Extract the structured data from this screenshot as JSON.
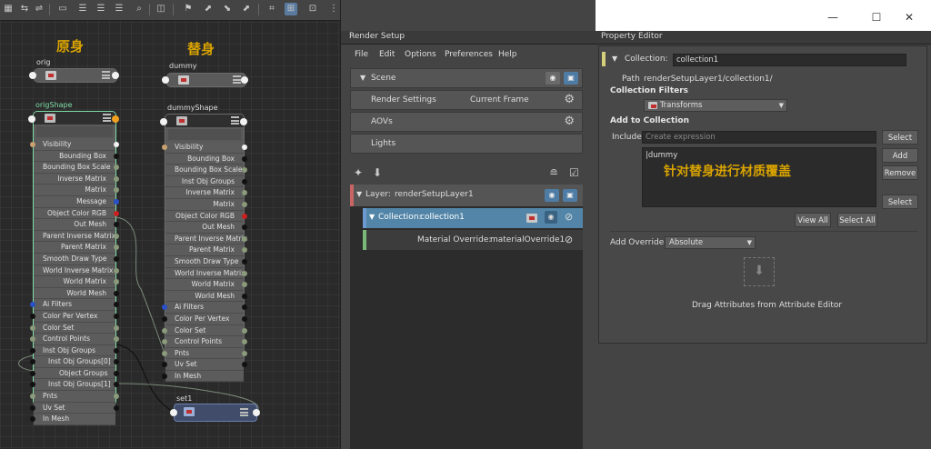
{
  "node_editor": {
    "label_orig_cn": "原身",
    "label_dummy_cn": "替身",
    "orig_node": {
      "name": "orig"
    },
    "dummy_node": {
      "name": "dummy"
    },
    "orig_shape": {
      "name": "origShape",
      "rows": [
        "Visibility",
        "Bounding Box",
        "Bounding Box Scale",
        "Inverse Matrix",
        "Matrix",
        "Message",
        "Object Color RGB",
        "Out Mesh",
        "Parent Inverse Matrix",
        "Parent Matrix",
        "Smooth Draw Type",
        "World Inverse Matrix",
        "World Matrix",
        "World Mesh",
        "Ai Filters",
        "Color Per Vertex",
        "Color Set",
        "Control Points",
        "Inst Obj Groups",
        "Inst Obj Groups[0]",
        "Object Groups",
        "Inst Obj Groups[1]",
        "Pnts",
        "Uv Set",
        "In Mesh"
      ]
    },
    "dummy_shape": {
      "name": "dummyShape",
      "rows": [
        "Visibility",
        "Bounding Box",
        "Bounding Box Scale",
        "Inst Obj Groups",
        "Inverse Matrix",
        "Matrix",
        "Object Color RGB",
        "Out Mesh",
        "Parent Inverse Matrix",
        "Parent Matrix",
        "Smooth Draw Type",
        "World Inverse Matrix",
        "World Matrix",
        "World Mesh",
        "Ai Filters",
        "Color Per Vertex",
        "Color Set",
        "Control Points",
        "Pnts",
        "Uv Set",
        "In Mesh"
      ]
    },
    "set_node": {
      "name": "set1"
    }
  },
  "render_setup": {
    "window_title": "Render Setup",
    "panel_title": "Render Setup",
    "menu": [
      "File",
      "Edit",
      "Options",
      "Preferences",
      "Help"
    ],
    "scene_label": "Scene",
    "render_settings_label": "Render Settings",
    "current_frame_label": "Current Frame",
    "aovs_label": "AOVs",
    "lights_label": "Lights",
    "layer_prefix": "Layer:",
    "layer_name": "renderSetupLayer1",
    "collection_prefix": "Collection:",
    "collection_name": "collection1",
    "override_prefix": "Material Override:",
    "override_name": "materialOverride1"
  },
  "property_editor": {
    "tab_title": "Property Editor",
    "collection_label": "Collection:",
    "collection_value": "collection1",
    "path_label": "Path",
    "path_value": "renderSetupLayer1/collection1/",
    "filters_label": "Collection Filters",
    "filter_value": "Transforms",
    "add_to_collection_label": "Add to Collection",
    "include_label": "Include",
    "include_placeholder": "Create expression",
    "select_button": "Select",
    "add_button": "Add",
    "remove_button": "Remove",
    "select_button_2": "Select",
    "list_item": "|dummy",
    "annotation_cn": "针对替身进行材质覆盖",
    "view_all_button": "View All",
    "select_all_button": "Select All",
    "add_override_label": "Add Override",
    "add_override_value": "Absolute",
    "drag_hint": "Drag Attributes from Attribute Editor"
  },
  "colors": {
    "node_bg": "#5a5a5a",
    "selected_outline": "#7fdca8",
    "collection_highlight": "#5285a8",
    "annotation": "#d9a300",
    "layer_bar": "#c86464",
    "collection_bar": "#6a9ad0",
    "override_bar": "#7ab87a"
  }
}
